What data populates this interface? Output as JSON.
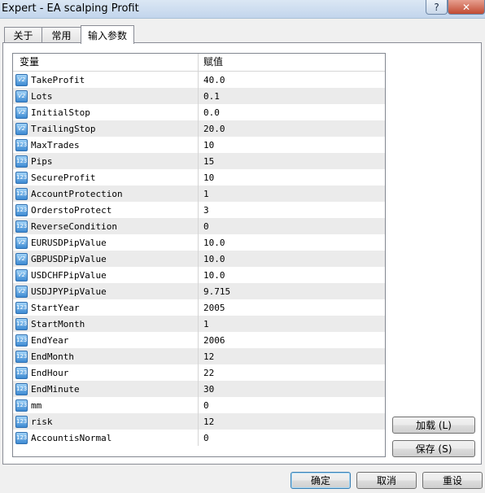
{
  "window": {
    "title": "Expert - EA scalping Profit",
    "help_label": "?",
    "close_label": "✕"
  },
  "tabs": [
    {
      "label": "关于"
    },
    {
      "label": "常用"
    },
    {
      "label": "输入参数"
    }
  ],
  "grid": {
    "columns": [
      "变量",
      "赋值"
    ],
    "rows": [
      {
        "name": "TakeProfit",
        "value": "40.0",
        "icon": "V2"
      },
      {
        "name": "Lots",
        "value": "0.1",
        "icon": "V2"
      },
      {
        "name": "InitialStop",
        "value": "0.0",
        "icon": "V2"
      },
      {
        "name": "TrailingStop",
        "value": "20.0",
        "icon": "V2"
      },
      {
        "name": "MaxTrades",
        "value": "10",
        "icon": "123"
      },
      {
        "name": "Pips",
        "value": "15",
        "icon": "123"
      },
      {
        "name": "SecureProfit",
        "value": "10",
        "icon": "123"
      },
      {
        "name": "AccountProtection",
        "value": "1",
        "icon": "123"
      },
      {
        "name": "OrderstoProtect",
        "value": "3",
        "icon": "123"
      },
      {
        "name": "ReverseCondition",
        "value": "0",
        "icon": "123"
      },
      {
        "name": "EURUSDPipValue",
        "value": "10.0",
        "icon": "V2"
      },
      {
        "name": "GBPUSDPipValue",
        "value": "10.0",
        "icon": "V2"
      },
      {
        "name": "USDCHFPipValue",
        "value": "10.0",
        "icon": "V2"
      },
      {
        "name": "USDJPYPipValue",
        "value": "9.715",
        "icon": "V2"
      },
      {
        "name": "StartYear",
        "value": "2005",
        "icon": "123"
      },
      {
        "name": "StartMonth",
        "value": "1",
        "icon": "123"
      },
      {
        "name": "EndYear",
        "value": "2006",
        "icon": "123"
      },
      {
        "name": "EndMonth",
        "value": "12",
        "icon": "123"
      },
      {
        "name": "EndHour",
        "value": "22",
        "icon": "123"
      },
      {
        "name": "EndMinute",
        "value": "30",
        "icon": "123"
      },
      {
        "name": "mm",
        "value": "0",
        "icon": "123"
      },
      {
        "name": "risk",
        "value": "12",
        "icon": "123"
      },
      {
        "name": "AccountisNormal",
        "value": "0",
        "icon": "123"
      }
    ]
  },
  "side_buttons": {
    "load_label": "加载 (L)",
    "save_label": "保存 (S)"
  },
  "footer_buttons": {
    "ok_label": "确定",
    "cancel_label": "取消",
    "reset_label": "重设"
  },
  "colors": {
    "icon_blue": "#3d8ad2",
    "alt_row": "#ebebeb",
    "default_button_border": "#3c7fb1"
  }
}
